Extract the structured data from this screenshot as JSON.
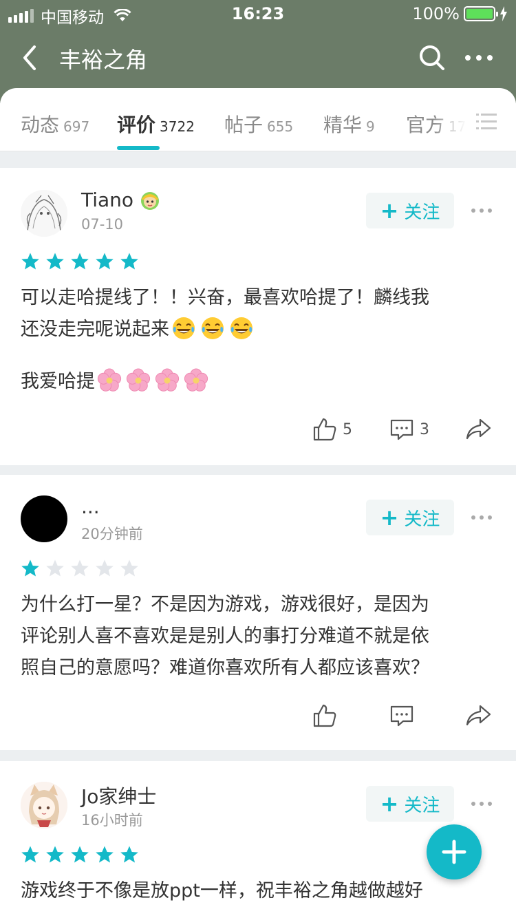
{
  "status_bar": {
    "carrier": "中国移动",
    "time": "16:23",
    "battery": "100%"
  },
  "nav": {
    "title": "丰裕之角"
  },
  "tabs": [
    {
      "label": "动态",
      "count": "697"
    },
    {
      "label": "评价",
      "count": "3722",
      "active": true
    },
    {
      "label": "帖子",
      "count": "655"
    },
    {
      "label": "精华",
      "count": "9"
    },
    {
      "label": "官方",
      "count": "17"
    }
  ],
  "follow_label": "关注",
  "reviews": [
    {
      "user": "Tiano",
      "time": "07-10",
      "rating": 5,
      "text_lines": [
        "可以走哈提线了！！兴奋，最喜欢哈提了！麟线我",
        "还没走完呢说起来"
      ],
      "line2": "我爱哈提",
      "likes": "5",
      "comments": "3"
    },
    {
      "user": "...",
      "time": "20分钟前",
      "rating": 1,
      "text_lines": [
        "为什么打一星？不是因为游戏，游戏很好，是因为",
        "评论别人喜不喜欢是是别人的事打分难道不就是依",
        "照自己的意愿吗？难道你喜欢所有人都应该喜欢？"
      ],
      "likes": "",
      "comments": ""
    },
    {
      "user": "Jo家绅士",
      "time": "16小时前",
      "rating": 5,
      "text_lines": [
        "游戏终于不像是放ppt一样，祝丰裕之角越做越好"
      ]
    }
  ],
  "colors": {
    "header": "#6b7c68",
    "accent": "#14b9c8",
    "star_empty": "#e3e6ea"
  }
}
